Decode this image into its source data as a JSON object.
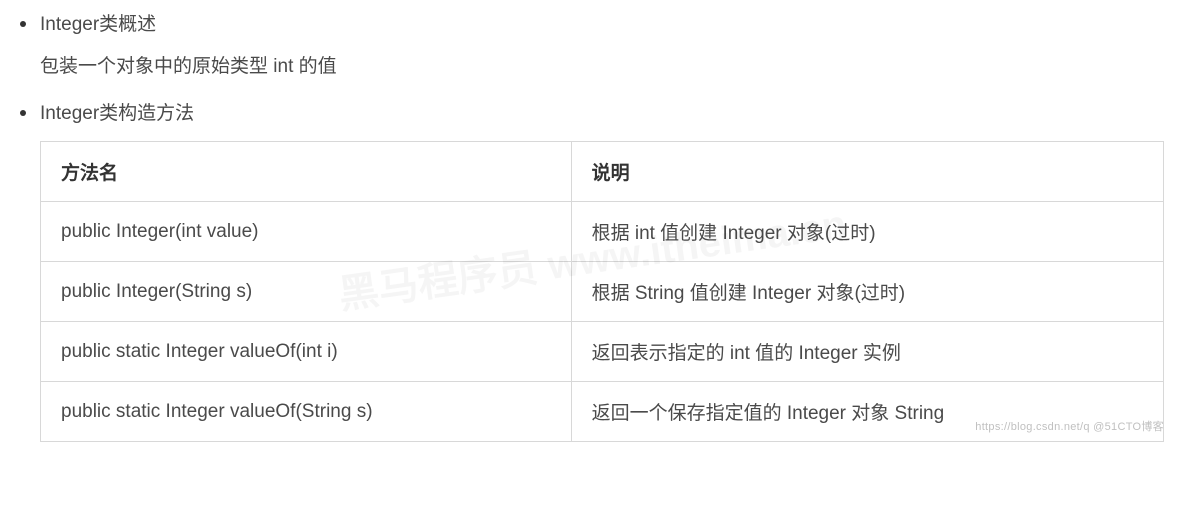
{
  "bullets": [
    {
      "title": "Integer类概述",
      "desc": "包装一个对象中的原始类型 int 的值"
    },
    {
      "title": "Integer类构造方法"
    }
  ],
  "table": {
    "headers": [
      "方法名",
      "说明"
    ],
    "rows": [
      [
        "public Integer(int value)",
        "根据 int 值创建 Integer 对象(过时)"
      ],
      [
        "public Integer(String s)",
        "根据 String 值创建 Integer 对象(过时)"
      ],
      [
        "public static Integer valueOf(int i)",
        "返回表示指定的 int 值的 Integer 实例"
      ],
      [
        "public static Integer valueOf(String s)",
        "返回一个保存指定值的 Integer 对象 String"
      ]
    ]
  },
  "watermark": {
    "bottom": "https://blog.csdn.net/q        @51CTO博客",
    "center": "黑马程序员 www.itheima.cn"
  }
}
